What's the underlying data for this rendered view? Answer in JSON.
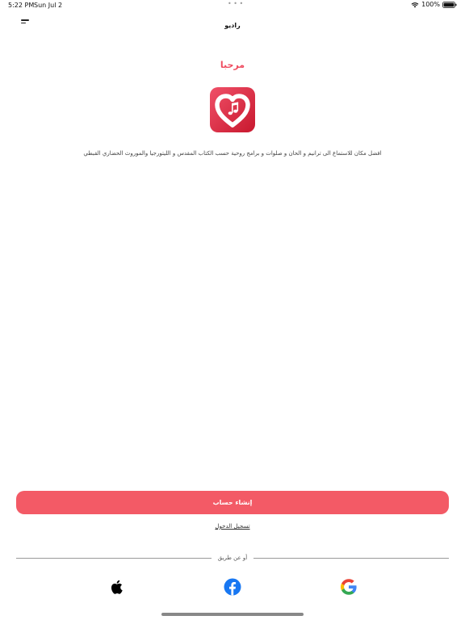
{
  "status_bar": {
    "time": "5:22 PM",
    "date": "Sun Jul 2",
    "dots": "• • •",
    "battery": "100%"
  },
  "nav": {
    "title": "راديو",
    "menu_icon": "menu-icon"
  },
  "welcome": {
    "title": "مرحبا",
    "description": "افضل مكان للاستماع الى ترانيم و الحان و صلوات و برامج روحية حسب الكتاب المقدس و الليتورجيا والموروث الحضاري القبطي"
  },
  "actions": {
    "create_account": "إنشاء حساب",
    "login": "تسجيل الدخول",
    "or_via": "أو عن طريق"
  },
  "social": {
    "apple": "apple-icon",
    "facebook": "facebook-icon",
    "google": "google-icon"
  },
  "colors": {
    "accent": "#f35a66",
    "title_red": "#ef4b5f",
    "facebook_blue": "#1877f2"
  }
}
